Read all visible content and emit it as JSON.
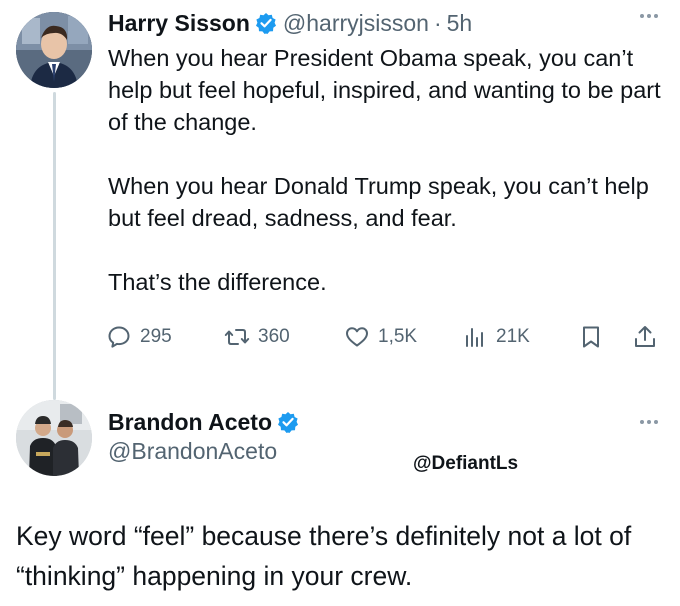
{
  "tweet": {
    "author_name": "Harry Sisson",
    "author_handle": "@harryjsisson",
    "separator": "·",
    "time": "5h",
    "paragraphs": [
      "When you hear President Obama speak, you can’t help but feel hopeful, inspired, and wanting to be part of the change.",
      "When you hear Donald Trump speak, you can’t help but feel dread, sadness, and fear.",
      "That’s the difference."
    ],
    "stats": {
      "replies": "295",
      "retweets": "360",
      "likes": "1,5K",
      "views": "21K"
    }
  },
  "reply_card": {
    "author_name": "Brandon Aceto",
    "author_handle": "@BrandonAceto",
    "watermark": "@DefiantLs"
  },
  "reply_text": "Key word “feel” because there’s definitely not a lot of “thinking” happening in your crew.",
  "colors": {
    "verified": "#1d9bf0",
    "secondary_text": "#536471",
    "thread_line": "#cfd9de"
  }
}
